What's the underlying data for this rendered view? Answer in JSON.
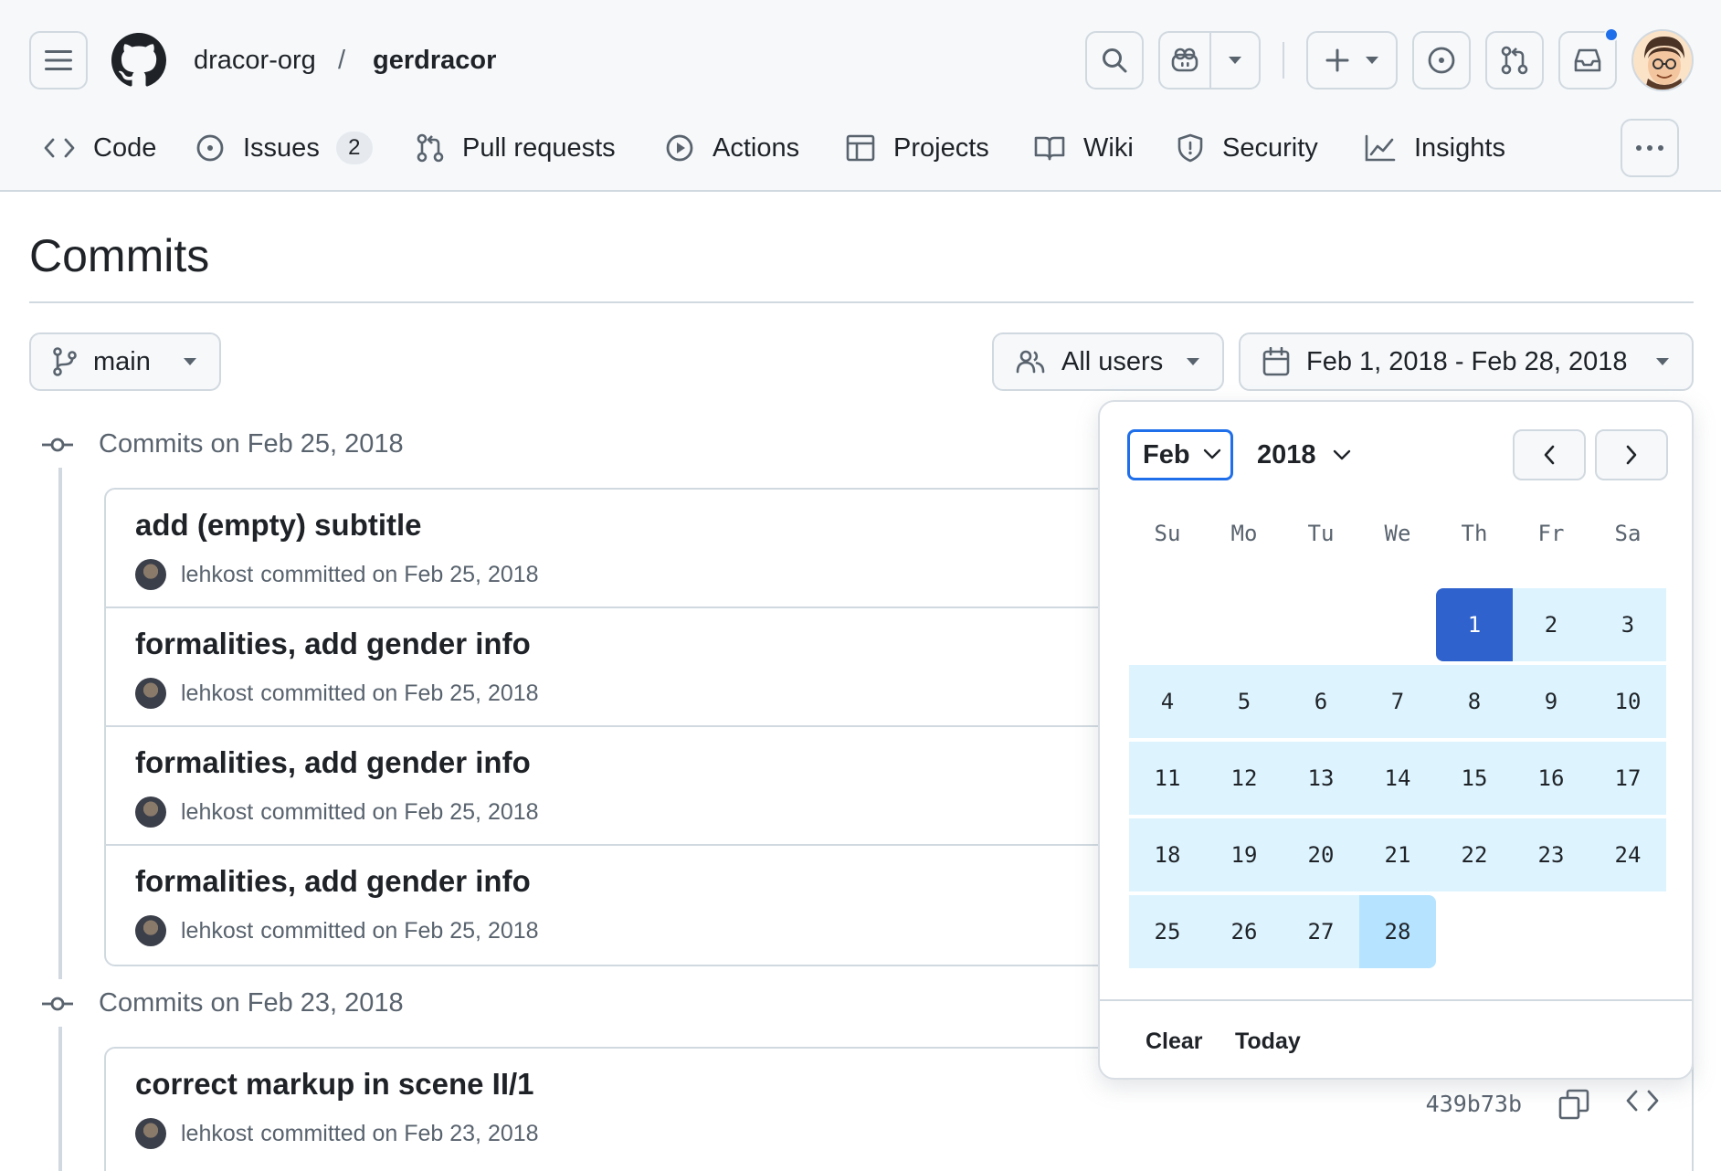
{
  "header": {
    "org": "dracor-org",
    "separator": "/",
    "repo": "gerdracor",
    "tabs": [
      {
        "label": "Code",
        "icon": "code-icon"
      },
      {
        "label": "Issues",
        "icon": "issue-opened-icon",
        "count": "2"
      },
      {
        "label": "Pull requests",
        "icon": "git-pull-request-icon"
      },
      {
        "label": "Actions",
        "icon": "play-icon"
      },
      {
        "label": "Projects",
        "icon": "table-icon"
      },
      {
        "label": "Wiki",
        "icon": "book-icon"
      },
      {
        "label": "Security",
        "icon": "shield-icon"
      },
      {
        "label": "Insights",
        "icon": "graph-icon"
      }
    ],
    "notification_dot_color": "#1f6feb"
  },
  "page": {
    "title": "Commits"
  },
  "filters": {
    "branch": "main",
    "users": "All users",
    "date_range": "Feb 1, 2018 - Feb 28, 2018"
  },
  "commit_groups": [
    {
      "heading": "Commits on Feb 25, 2018",
      "commits": [
        {
          "title": "add (empty) subtitle",
          "author": "lehkost",
          "meta": "committed on Feb 25, 2018"
        },
        {
          "title": "formalities, add gender info",
          "author": "lehkost",
          "meta": "committed on Feb 25, 2018"
        },
        {
          "title": "formalities, add gender info",
          "author": "lehkost",
          "meta": "committed on Feb 25, 2018"
        },
        {
          "title": "formalities, add gender info",
          "author": "lehkost",
          "meta": "committed on Feb 25, 2018"
        }
      ]
    },
    {
      "heading": "Commits on Feb 23, 2018",
      "commits": [
        {
          "title": "correct markup in scene II/1",
          "author": "lehkost",
          "meta": "committed on Feb 23, 2018",
          "sha": "439b73b"
        }
      ]
    }
  ],
  "datepicker": {
    "month": "Feb",
    "year": "2018",
    "weekdays": [
      "Su",
      "Mo",
      "Tu",
      "We",
      "Th",
      "Fr",
      "Sa"
    ],
    "days": [
      "",
      "",
      "",
      "",
      "1",
      "2",
      "3",
      "4",
      "5",
      "6",
      "7",
      "8",
      "9",
      "10",
      "11",
      "12",
      "13",
      "14",
      "15",
      "16",
      "17",
      "18",
      "19",
      "20",
      "21",
      "22",
      "23",
      "24",
      "25",
      "26",
      "27",
      "28"
    ],
    "range_start": "1",
    "range_end": "28",
    "clear_label": "Clear",
    "today_label": "Today",
    "colors": {
      "range": "#ddf4ff",
      "start": "#2f62cc",
      "end": "#b6e3ff",
      "focus": "#1f6feb"
    }
  }
}
